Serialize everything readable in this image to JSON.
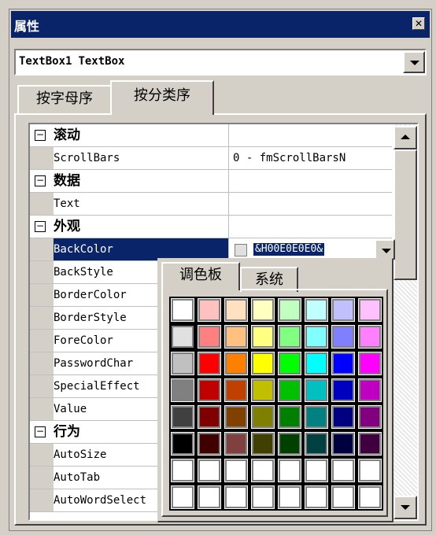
{
  "window": {
    "title": "属性"
  },
  "object_selector": {
    "name": "TextBox1",
    "type": "TextBox"
  },
  "tabs": [
    {
      "label": "按字母序"
    },
    {
      "label": "按分类序"
    }
  ],
  "rows": [
    {
      "kind": "category",
      "toggle": "⊟",
      "label": "滚动"
    },
    {
      "kind": "prop",
      "name": "ScrollBars",
      "value": "0 - fmScrollBarsN"
    },
    {
      "kind": "category",
      "toggle": "⊟",
      "label": "数据"
    },
    {
      "kind": "prop",
      "name": "Text",
      "value": ""
    },
    {
      "kind": "category",
      "toggle": "⊟",
      "label": "外观"
    },
    {
      "kind": "prop",
      "name": "BackColor",
      "value": "&H00E0E0E0&",
      "selected": true
    },
    {
      "kind": "prop",
      "name": "BackStyle",
      "value": ""
    },
    {
      "kind": "prop",
      "name": "BorderColor",
      "value": ""
    },
    {
      "kind": "prop",
      "name": "BorderStyle",
      "value": ""
    },
    {
      "kind": "prop",
      "name": "ForeColor",
      "value": ""
    },
    {
      "kind": "prop",
      "name": "PasswordChar",
      "value": ""
    },
    {
      "kind": "prop",
      "name": "SpecialEffect",
      "value": ""
    },
    {
      "kind": "prop",
      "name": "Value",
      "value": ""
    },
    {
      "kind": "category",
      "toggle": "⊟",
      "label": "行为"
    },
    {
      "kind": "prop",
      "name": "AutoSize",
      "value": ""
    },
    {
      "kind": "prop",
      "name": "AutoTab",
      "value": ""
    },
    {
      "kind": "prop",
      "name": "AutoWordSelect",
      "value": ""
    }
  ],
  "palette": {
    "tabs": [
      {
        "label": "调色板"
      },
      {
        "label": "系统"
      }
    ],
    "selected": [
      1,
      0
    ],
    "colors": [
      [
        "#ffffff",
        "#ffc0c0",
        "#ffe0c0",
        "#ffffc0",
        "#c0ffc0",
        "#c0ffff",
        "#c0c0ff",
        "#ffc0ff"
      ],
      [
        "#e0e0e0",
        "#ff8080",
        "#ffc080",
        "#ffff80",
        "#80ff80",
        "#80ffff",
        "#8080ff",
        "#ff80ff"
      ],
      [
        "#c0c0c0",
        "#ff0000",
        "#ff8000",
        "#ffff00",
        "#00ff00",
        "#00ffff",
        "#0000ff",
        "#ff00ff"
      ],
      [
        "#808080",
        "#c00000",
        "#c04000",
        "#c0c000",
        "#00c000",
        "#00c0c0",
        "#0000c0",
        "#c000c0"
      ],
      [
        "#404040",
        "#800000",
        "#804000",
        "#808000",
        "#008000",
        "#008080",
        "#000080",
        "#800080"
      ],
      [
        "#000000",
        "#400000",
        "#804040",
        "#404000",
        "#004000",
        "#004040",
        "#000040",
        "#400040"
      ],
      [
        "#ffffff",
        "#ffffff",
        "#ffffff",
        "#ffffff",
        "#ffffff",
        "#ffffff",
        "#ffffff",
        "#ffffff"
      ],
      [
        "#ffffff",
        "#ffffff",
        "#ffffff",
        "#ffffff",
        "#ffffff",
        "#ffffff",
        "#ffffff",
        "#ffffff"
      ]
    ]
  },
  "icons": {
    "close": "close-icon",
    "dropdown": "chevron-down-icon",
    "scroll_up": "arrow-up-icon",
    "scroll_down": "arrow-down-icon"
  },
  "theme": {
    "titlebar": "#0a246a",
    "face": "#d4d0c8",
    "selection": "#0a246a"
  }
}
